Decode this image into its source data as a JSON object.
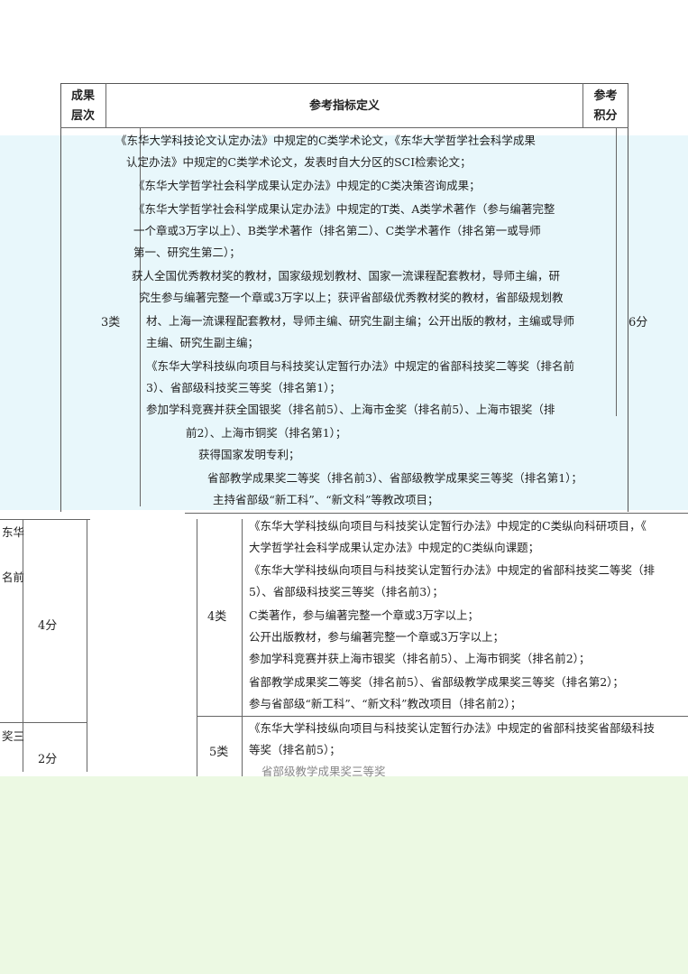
{
  "header": {
    "col_level": "成果层次",
    "col_level_l1": "成果",
    "col_level_l2": "层次",
    "col_def": "参考指标定义",
    "col_score_l1": "参考",
    "col_score_l2": "积分"
  },
  "row3": {
    "level": "3类",
    "score": "6分",
    "lines": [
      "《东华大学科技论文认定办法》中规定的C类学术论文，《东华大学哲学社会科学成果",
      "认定办法》中规定的C类学术论文，发表时自大分区的SCI检索论文；",
      "《东华大学哲学社会科学成果认定办法》中规定的C类决策咨询成果；",
      "《东华大学哲学社会科学成果认定办法》中规定的T类、A类学术著作（参与编著完整",
      "一个章或3万字以上）、B类学术著作（排名第二）、C类学术著作（排名第一或导师",
      "第一、研究生第二）；",
      "获人全国优秀教材奖的教材，国家级规划教材、国家一流课程配套教材，导师主编，研",
      "究生参与编著完整一个章或3万字以上；获评省部级优秀教材奖的教材，省部级规划教",
      "材、上海一流课程配套教材，导师主编、研究生副主编；公开出版的教材，主编或导师",
      "主编、研究生副主编；",
      "《东华大学科技纵向项目与科技奖认定暂行办法》中规定的省部科技奖二等奖（排名前",
      "3）、省部级科技奖三等奖（排名第1）；",
      "参加学科竞赛并获全国银奖（排名前5）、上海市金奖（排名前5）、上海市银奖（排",
      "前2）、上海市铜奖（排名第1）；",
      "获得国家发明专利；",
      "省部教学成果奖二等奖（排名前3）、省部级教学成果奖三等奖（排名第1）；",
      "主持省部级“新工科”、“新文科”等教改项目；"
    ]
  },
  "row4": {
    "level": "4类",
    "score": "4分",
    "left_fragments": [
      "东华",
      "名前"
    ],
    "lines": [
      "《东华大学科技纵向项目与科技奖认定暂行办法》中规定的C类纵向科研项目，《",
      "大学哲学社会科学成果认定办法》中规定的C类纵向课题；",
      "《东华大学科技纵向项目与科技奖认定暂行办法》中规定的省部科技奖二等奖（排",
      "5）、省部级科技奖三等奖（排名前3）；",
      "C类著作，参与编著完整一个章或3万字以上；",
      "公开出版教材，参与编著完整一个章或3万字以上；",
      "参加学科竞赛并获上海市银奖（排名前5）、上海市铜奖（排名前2）；",
      "省部教学成果奖二等奖（排名前5）、省部级教学成果奖三等奖（排名第2）；",
      "参与省部级“新工科”、“新文科”教改项目（排名前2）；"
    ]
  },
  "row5": {
    "level": "5类",
    "score": "2分",
    "left_fragment": "奖三",
    "lines": [
      "《东华大学科技纵向项目与科技奖认定暂行办法》中规定的省部科技奖省部级科技",
      "等奖（排名前5）；",
      "省部级教学成果奖三等奖"
    ]
  }
}
